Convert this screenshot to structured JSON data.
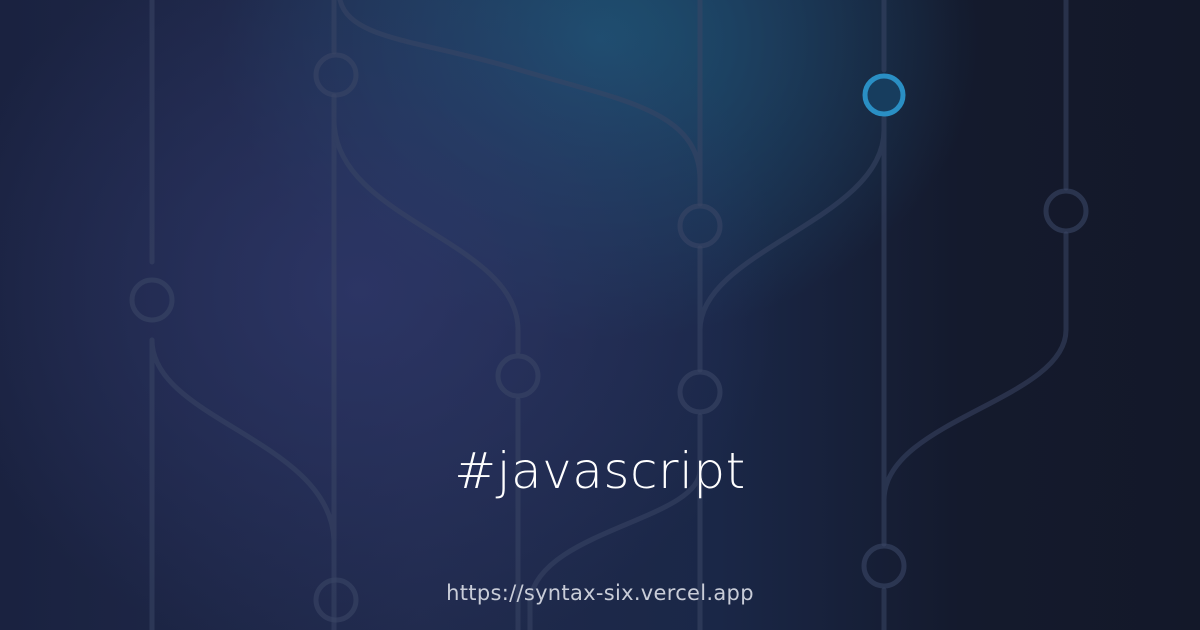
{
  "card": {
    "tag": "#javascript",
    "url": "https://syntax-six.vercel.app"
  },
  "colors": {
    "background": "#1a2240",
    "line": "#3b4766",
    "accent_node": "#2a8fc4",
    "text": "#ffffff",
    "url_text": "#c9cdd8"
  },
  "icons": [
    "git-branch-graph-background",
    "commit-node-icon",
    "highlighted-commit-node-icon"
  ]
}
